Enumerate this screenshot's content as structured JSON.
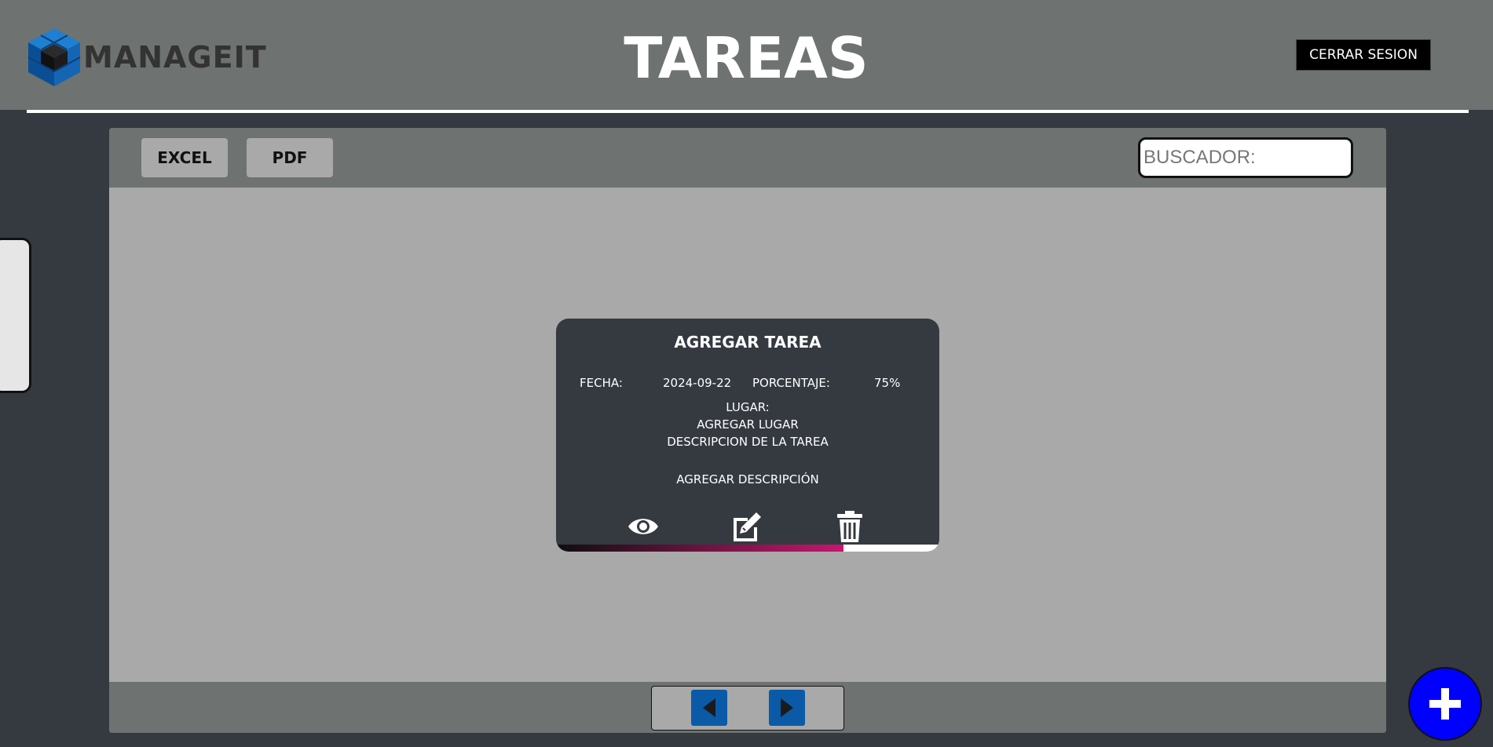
{
  "header": {
    "logo_text": "MANAGEIT",
    "title": "TAREAS",
    "logout_label": "CERRAR SESION"
  },
  "toolbar": {
    "excel_label": "EXCEL",
    "pdf_label": "PDF",
    "search_placeholder": "BUSCADOR:"
  },
  "task_card": {
    "title": "AGREGAR TAREA",
    "date_label": "FECHA:",
    "date_value": "2024-09-22",
    "percent_label": "PORCENTAJE:",
    "percent_value": "75%",
    "progress": 0.75,
    "place_label": "LUGAR:",
    "place_value": "AGREGAR LUGAR",
    "description_label": "DESCRIPCION DE LA TAREA",
    "description_value": "AGREGAR DESCRIPCIÓN",
    "icons": [
      "eye-icon",
      "edit-icon",
      "trash-icon"
    ]
  },
  "pagination": {
    "icons": [
      "prev-arrow-icon",
      "next-arrow-icon"
    ]
  },
  "fab": {
    "icon": "plus-icon"
  },
  "colors": {
    "header_bg": "#6e7270",
    "body_bg": "#353940",
    "panel_bg": "#a9a9a9",
    "accent_blue": "#0a5aa8",
    "fab_blue": "#0000ff",
    "progress_end": "#c5176f"
  }
}
